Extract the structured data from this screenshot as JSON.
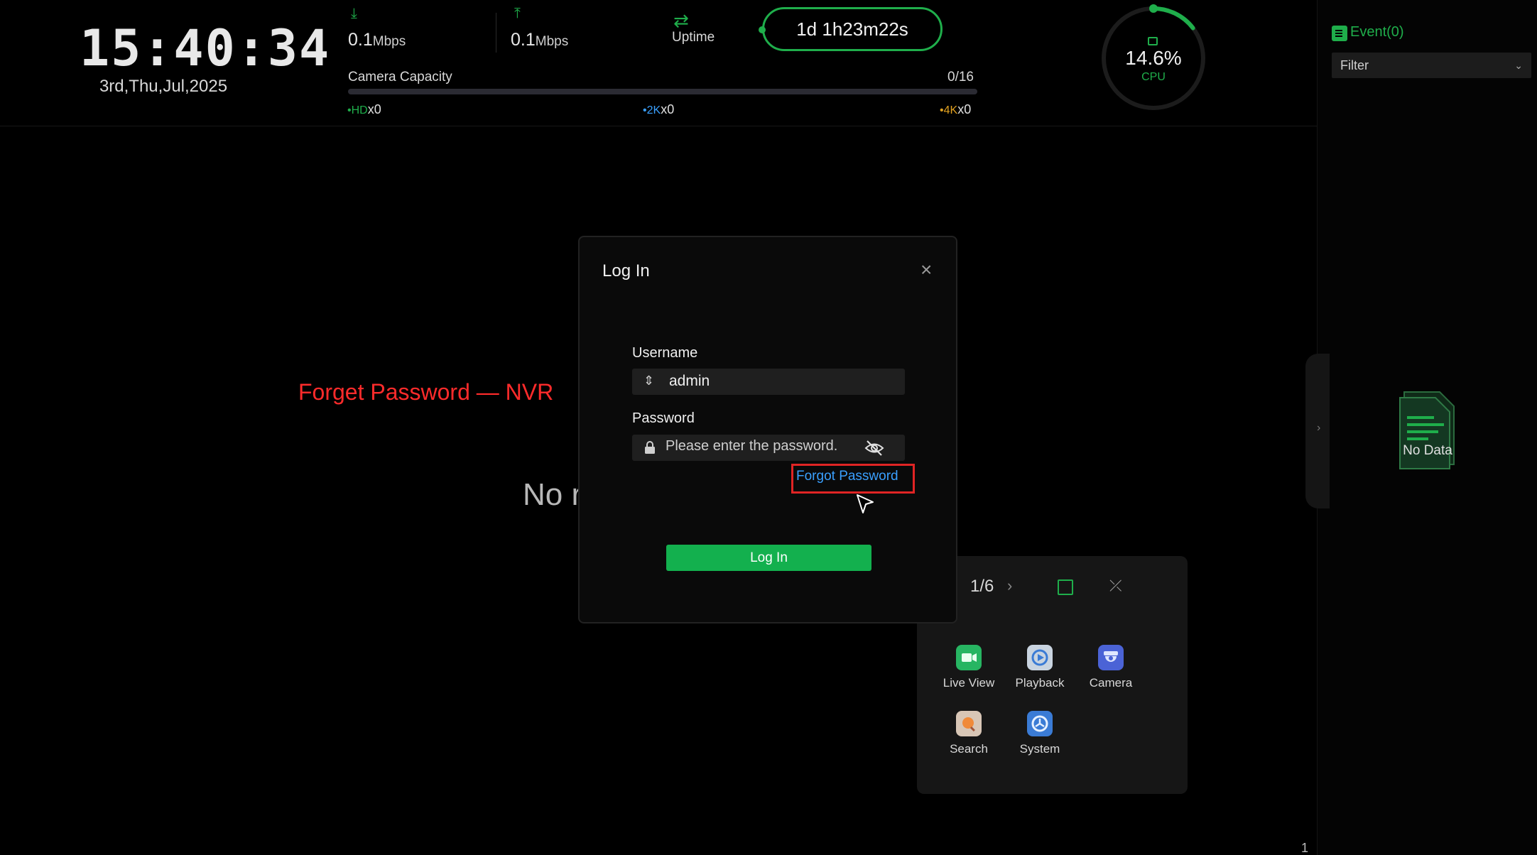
{
  "clock": {
    "time": "15:40:34",
    "date": "3rd,Thu,Jul,2025"
  },
  "network": {
    "download": {
      "value": "0.1",
      "unit": "Mbps"
    },
    "upload": {
      "value": "0.1",
      "unit": "Mbps"
    }
  },
  "uptime": {
    "label": "Uptime",
    "value": "1d 1h23m22s"
  },
  "camera_capacity": {
    "label": "Camera Capacity",
    "count": "0/16",
    "used": 0,
    "total": 16,
    "legend": [
      {
        "tag": "HD",
        "count": "x0",
        "color": "#1fae4b"
      },
      {
        "tag": "2K",
        "count": "x0",
        "color": "#3aa0ff"
      },
      {
        "tag": "4K",
        "count": "x0",
        "color": "#e0a020"
      }
    ]
  },
  "cpu": {
    "value": "14.6%",
    "label": "CPU",
    "percent": 14.6
  },
  "events": {
    "label": "Event(0)",
    "filter_label": "Filter",
    "empty_label": "No Data"
  },
  "annotation": "Forget Password — NVR",
  "main": {
    "no_record_text": "No r",
    "page_number": "1"
  },
  "quick_menu": {
    "page": "1/6",
    "items": [
      {
        "label": "Live View",
        "icon": "live-view-icon"
      },
      {
        "label": "Playback",
        "icon": "playback-icon"
      },
      {
        "label": "Camera",
        "icon": "camera-icon"
      },
      {
        "label": "Search",
        "icon": "search-icon"
      },
      {
        "label": "System",
        "icon": "system-icon"
      }
    ]
  },
  "login": {
    "title": "Log In",
    "username_label": "Username",
    "username_value": "admin",
    "password_label": "Password",
    "password_placeholder": "Please enter the password.",
    "forgot_label": "Forgot Password",
    "submit_label": "Log In"
  },
  "colors": {
    "accent": "#1fae4b",
    "link": "#3aa0ff",
    "highlight": "#e02424",
    "annotation": "#ff2b2b"
  }
}
